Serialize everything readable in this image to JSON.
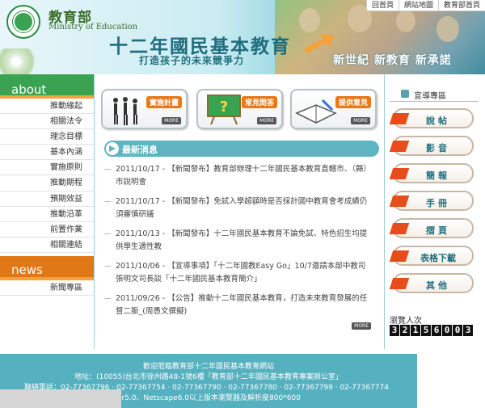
{
  "header": {
    "org_zh": "教育部",
    "org_en": "Ministry of Education",
    "title": "十二年國民基本教育",
    "subtitle": "打造孩子的未來競爭力",
    "slogan": "新世紀 新教育 新承諾",
    "top_links": [
      "回首頁",
      "網站地圖",
      "教育部首頁"
    ]
  },
  "sidebar": {
    "about_label": "about",
    "about_items": [
      "推動緣起",
      "相關法令",
      "理念目標",
      "基本內涵",
      "實施原則",
      "推動期程",
      "預期效益",
      "推動沿革",
      "前置作業",
      "相關連結"
    ],
    "news_label": "news",
    "news_items": [
      "新聞專區"
    ]
  },
  "features": [
    {
      "label": "實施計畫",
      "more": "MORE"
    },
    {
      "label": "常見問答",
      "more": "MORE"
    },
    {
      "label": "提供意見",
      "more": "MORE"
    }
  ],
  "news": {
    "title": "最新消息",
    "items": [
      "2011/10/17 - 【新聞發布】教育部辦理十二年國民基本教育直轄市、（縣）市說明會",
      "2011/10/17 - 【新聞發布】免試入學超額時是否採計國中教育會考成績仍須審慎研議",
      "2011/10/13 - 【新聞發布】十二年國民基本教育不論免試、特色招生均提供學生適性教",
      "2011/10/06 - 【宣導事項】「十二年國教Easy Go」10/7邀請本部中教司張明文司長談「十二年國民基本教育簡介」",
      "2011/09/26 - 【公告】推動十二年國民基本教育，打造未來教育發展的任督二脈_(周愚文撰擬)"
    ],
    "more": "MORE"
  },
  "promo": {
    "title": "宣導專區",
    "items": [
      "說帖",
      "影音",
      "簡報",
      "手冊",
      "摺頁",
      "表格下載",
      "其他"
    ]
  },
  "visitor": {
    "label": "瀏覽人次",
    "count": "32156003"
  },
  "footer": {
    "line1": "歡迎蒞臨教育部十二年國民基本教育網站",
    "line2": "地址：(10055)台北市徐州路48-1號6樓「教育部十二年國民基本教育專案辦公室」",
    "line3": "聯絡電話：02-7736779‌6 · 02-77367754 · 02-77367790 · 02-77367780 · 02-77367799 · 02-77367774",
    "line4": "ernet Explorer5.0、Netscape6.0以上版本瀏覽器及解析度800*600"
  },
  "colors": {
    "green": "#3aa352",
    "orange": "#e07818",
    "teal": "#55b0bf",
    "promo_red": "#e74c1a"
  }
}
